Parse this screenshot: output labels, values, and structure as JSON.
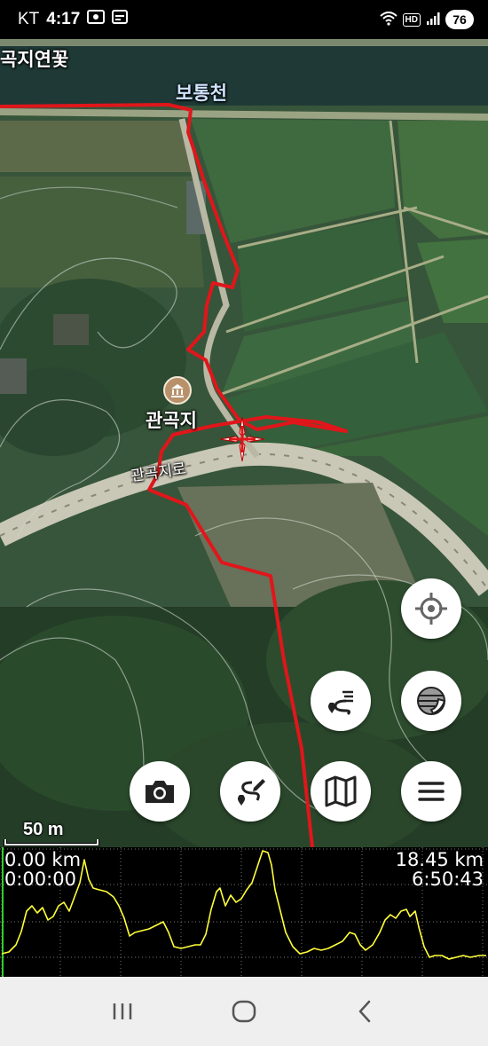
{
  "status_bar": {
    "carrier": "KT",
    "time": "4:17",
    "hd": "HD",
    "battery": "76",
    "icons": [
      "screenshot-icon",
      "calendar-icon",
      "wifi-icon",
      "signal-icon"
    ]
  },
  "map": {
    "labels": {
      "top_place": "곡지연꽃",
      "stream": "보통천",
      "place": "관곡지",
      "road": "관곡지로"
    },
    "poi_icon": "landmark-icon",
    "scale_label": "50 m",
    "route_color": "#e0161b",
    "buttons": {
      "locate": "crosshair-icon",
      "layers": "layers-icon",
      "route": "route-icon",
      "camera": "camera-icon",
      "edit_route": "edit-route-icon",
      "map": "map-icon",
      "menu": "menu-icon"
    }
  },
  "profile": {
    "start_distance": "0.00 km",
    "start_time": "0:00:00",
    "end_distance": "18.45 km",
    "end_time": "6:50:43",
    "line_color": "#ffff3a"
  },
  "nav_bar": {
    "icons": [
      "recent-apps-icon",
      "home-icon",
      "back-icon"
    ]
  }
}
